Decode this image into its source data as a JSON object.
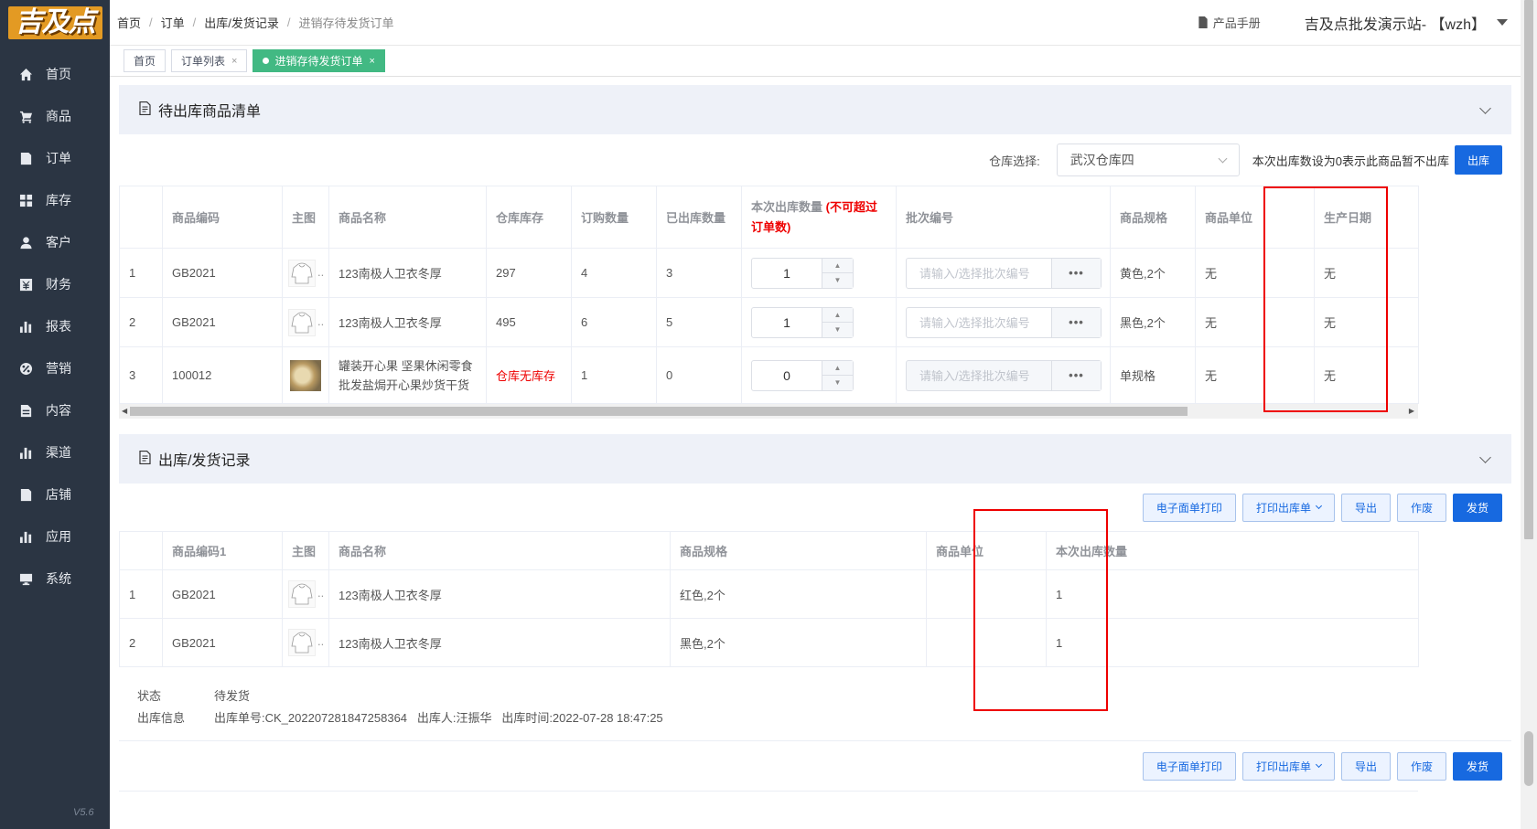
{
  "logo": "吉及点",
  "version": "V5.6",
  "sidebar": {
    "items": [
      {
        "label": "首页",
        "icon": "home-icon"
      },
      {
        "label": "商品",
        "icon": "cart-icon"
      },
      {
        "label": "订单",
        "icon": "order-icon"
      },
      {
        "label": "库存",
        "icon": "grid-icon"
      },
      {
        "label": "客户",
        "icon": "user-icon"
      },
      {
        "label": "财务",
        "icon": "finance-icon"
      },
      {
        "label": "报表",
        "icon": "bar-chart-icon"
      },
      {
        "label": "营销",
        "icon": "percent-icon"
      },
      {
        "label": "内容",
        "icon": "file-icon"
      },
      {
        "label": "渠道",
        "icon": "bar-chart-icon"
      },
      {
        "label": "店铺",
        "icon": "shop-icon"
      },
      {
        "label": "应用",
        "icon": "bar-chart-icon"
      },
      {
        "label": "系统",
        "icon": "monitor-icon"
      }
    ]
  },
  "breadcrumb": [
    "首页",
    "订单",
    "出库/发货记录",
    "进销存待发货订单"
  ],
  "header": {
    "manual": "产品手册",
    "site": "吉及点批发演示站-  【wzh】"
  },
  "tags": [
    {
      "label": "首页",
      "closable": false
    },
    {
      "label": "订单列表",
      "closable": true
    },
    {
      "label": "进销存待发货订单",
      "closable": true,
      "active": true
    }
  ],
  "panel1": {
    "title": "待出库商品清单",
    "warehouse_label": "仓库选择:",
    "warehouse_value": "武汉仓库四",
    "note": "本次出库数设为0表示此商品暂不出库",
    "submit": "出库",
    "columns": [
      "",
      "商品编码",
      "主图",
      "商品名称",
      "仓库库存",
      "订购数量",
      "已出库数量",
      "本次出库数量",
      "批次编号",
      "商品规格",
      "商品单位",
      "生产日期"
    ],
    "qty_col_note": "(不可超过订单数)",
    "batch_placeholder": "请输入/选择批次编号",
    "rows": [
      {
        "no": "1",
        "code": "GB2021",
        "name": "123南极人卫衣冬厚",
        "stock": "297",
        "ordered": "4",
        "shipped": "3",
        "qty": "1",
        "spec": "黄色,2个",
        "unit": "无",
        "date": "无"
      },
      {
        "no": "2",
        "code": "GB2021",
        "name": "123南极人卫衣冬厚",
        "stock": "495",
        "ordered": "6",
        "shipped": "5",
        "qty": "1",
        "spec": "黑色,2个",
        "unit": "无",
        "date": "无"
      },
      {
        "no": "3",
        "code": "100012",
        "name": "罐装开心果 坚果休闲零食批发盐焗开心果炒货干货",
        "stock": "仓库无库存",
        "ordered": "1",
        "shipped": "0",
        "qty": "0",
        "spec": "单规格",
        "unit": "无",
        "date": "无"
      }
    ]
  },
  "panel2": {
    "title": "出库/发货记录",
    "buttons": {
      "eprint": "电子面单打印",
      "print": "打印出库单",
      "export": "导出",
      "void": "作废",
      "ship": "发货"
    },
    "columns": [
      "",
      "商品编码1",
      "主图",
      "商品名称",
      "商品规格",
      "商品单位",
      "本次出库数量"
    ],
    "rows": [
      {
        "no": "1",
        "code": "GB2021",
        "name": "123南极人卫衣冬厚",
        "spec": "红色,2个",
        "unit": "",
        "qty": "1"
      },
      {
        "no": "2",
        "code": "GB2021",
        "name": "123南极人卫衣冬厚",
        "spec": "黑色,2个",
        "unit": "",
        "qty": "1"
      }
    ],
    "status_label": "状态",
    "status_value": "待发货",
    "info_label": "出库信息",
    "info_value": "出库单号:CK_202207281847258364   出库人:汪振华   出库时间:2022-07-28 18:47:25"
  },
  "colors": {
    "sidebar": "#2b3543",
    "primary": "#1769e0",
    "active_tag": "#42b983",
    "highlight": "#e00000"
  }
}
